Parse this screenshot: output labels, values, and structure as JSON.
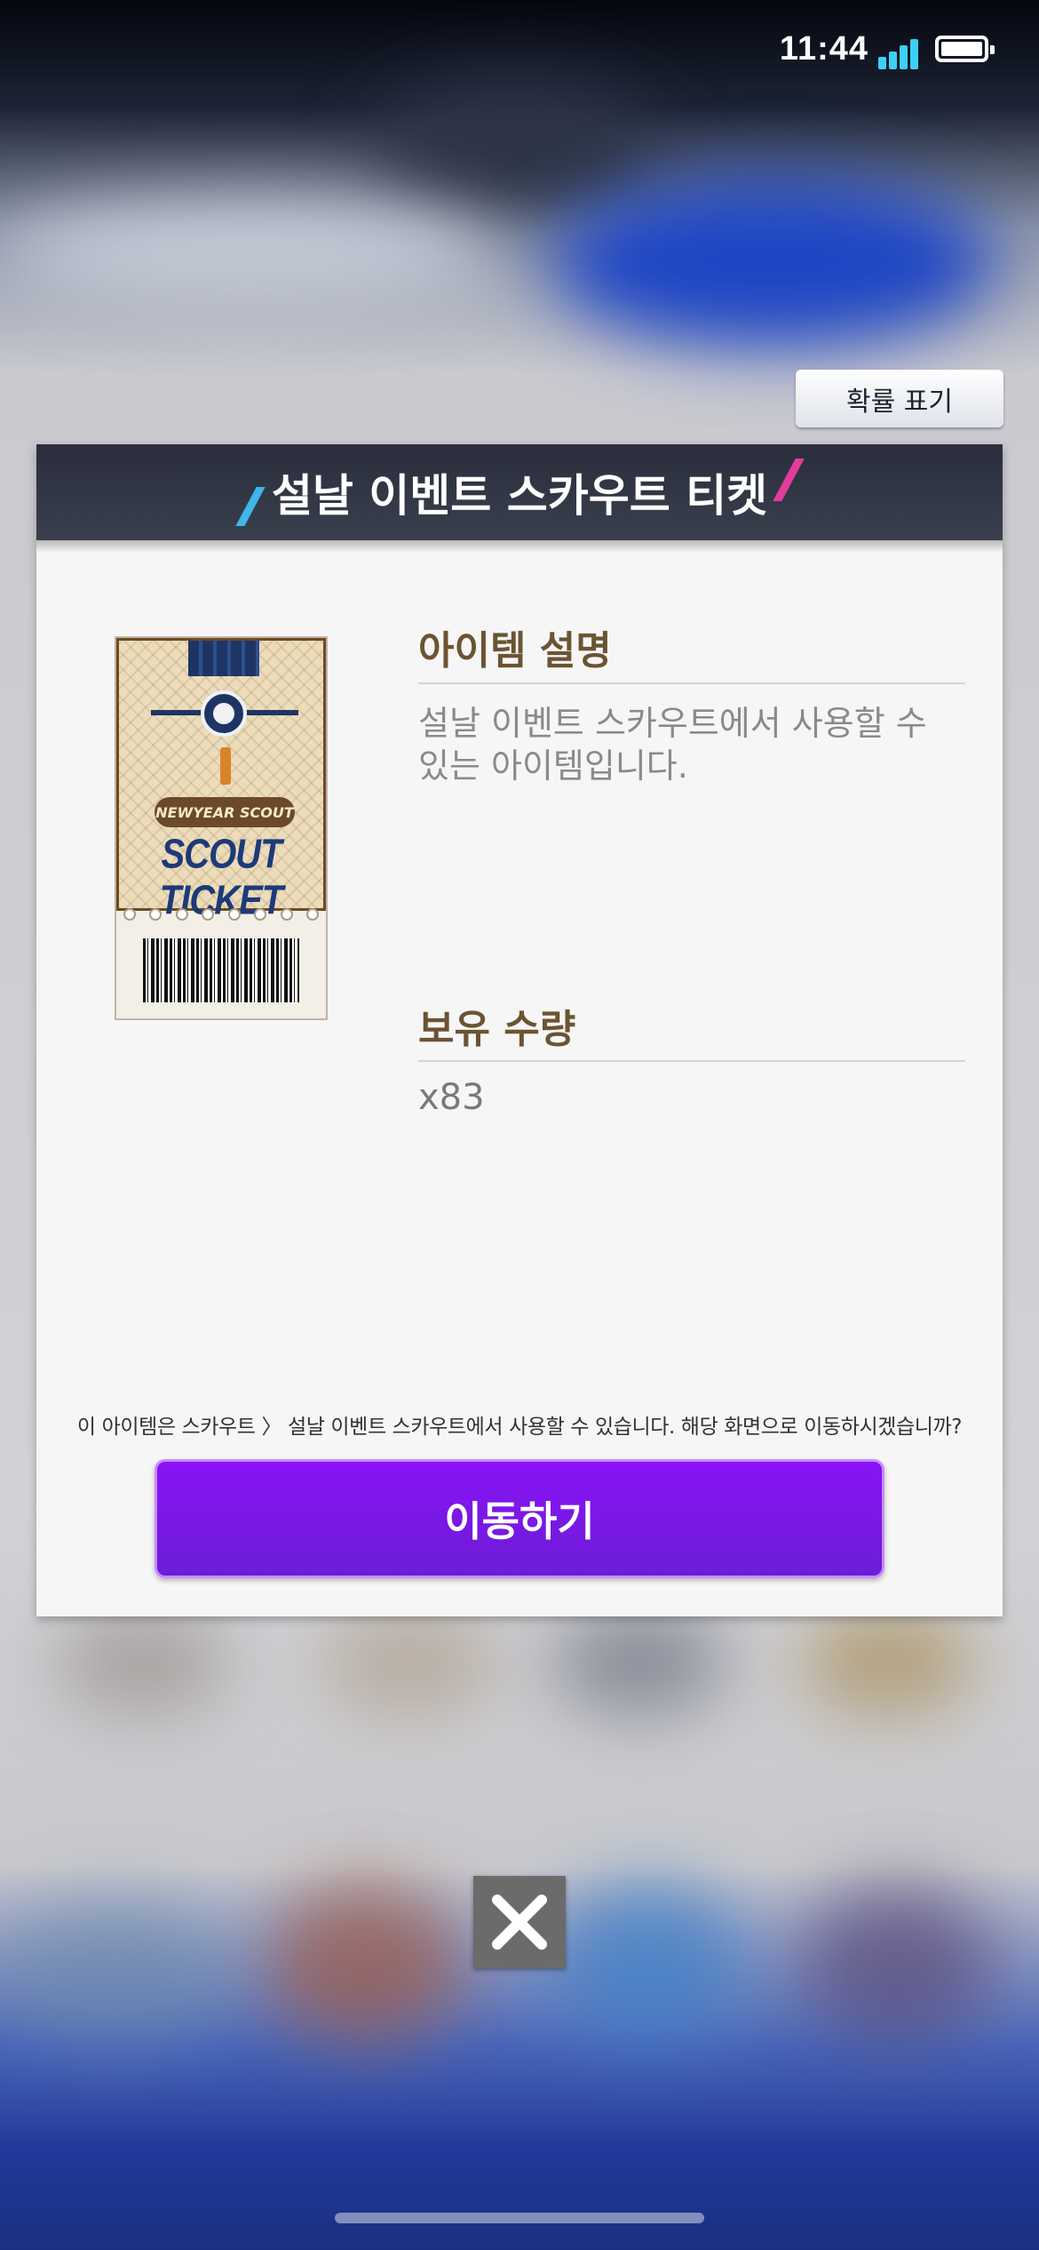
{
  "status_bar": {
    "time": "11:44"
  },
  "probability_button": {
    "label": "확률 표기"
  },
  "modal": {
    "title": "설날 이벤트 스카우트 티켓",
    "item_image": {
      "banner_text": "NEWYEAR SCOUT",
      "main_text": "SCOUT TICKET"
    },
    "description_title": "아이템 설명",
    "description_text": "설날 이벤트 스카우트에서 사용할 수 있는 아이템입니다.",
    "quantity_title": "보유 수량",
    "quantity_value": "x83",
    "notice": "이 아이템은 스카우트 〉 설날 이벤트 스카우트에서 사용할 수 있습니다. 해당 화면으로 이동하시겠습니까?",
    "go_button": "이동하기"
  },
  "icons": {
    "close": "close-icon",
    "signal": "signal-icon",
    "battery": "battery-icon"
  },
  "colors": {
    "accent_purple": "#8a12f5",
    "title_brown": "#6b5431",
    "header_dark": "#2a2e3c"
  }
}
